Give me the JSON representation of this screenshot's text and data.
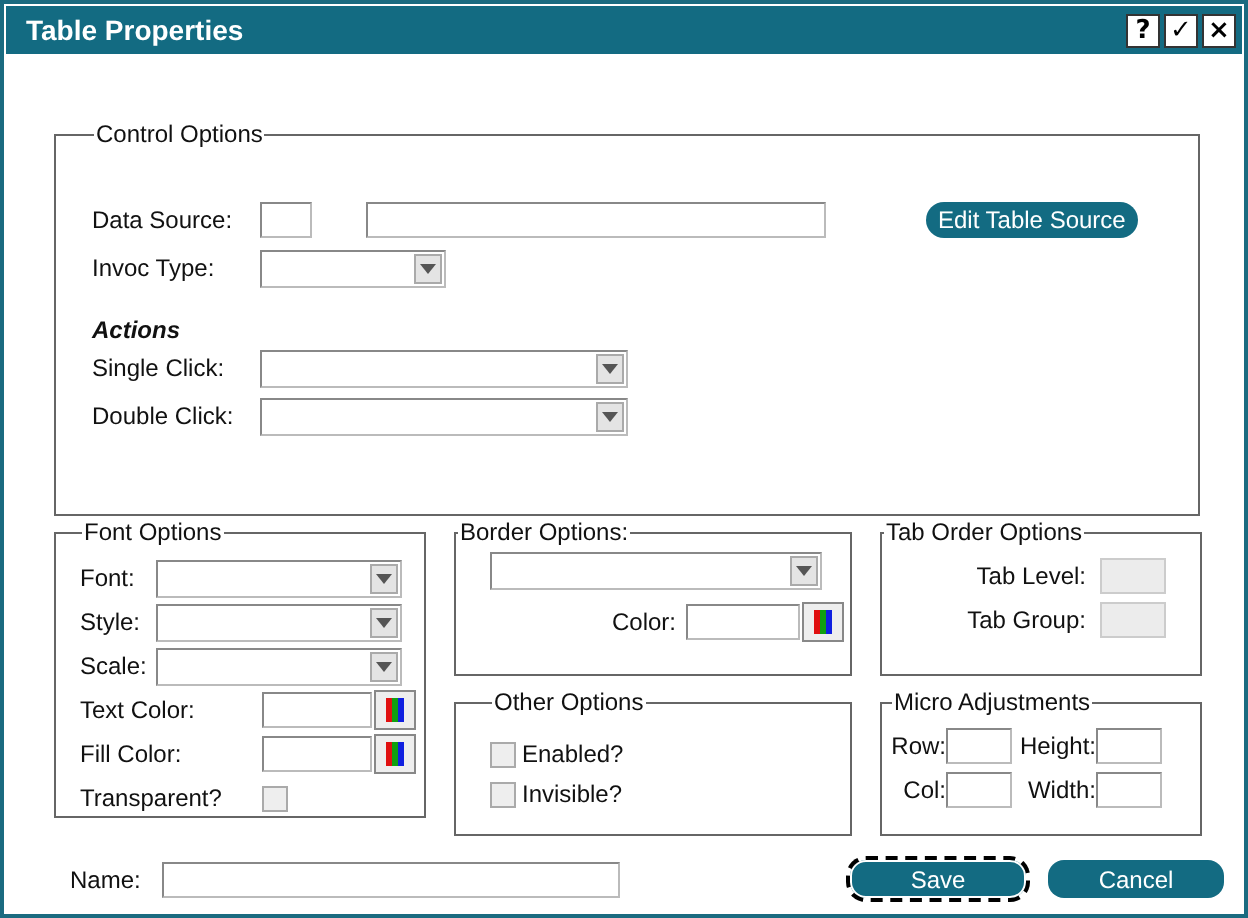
{
  "window": {
    "title": "Table Properties",
    "buttons": [
      "?",
      "✓",
      "×"
    ]
  },
  "control_options": {
    "legend": "Control Options",
    "data_source": {
      "label": "Data Source:"
    },
    "invoc_type": {
      "label": "Invoc Type:"
    },
    "edit_button": "Edit Table Source",
    "actions_heading": "Actions",
    "single_click": {
      "label": "Single Click:"
    },
    "double_click": {
      "label": "Double Click:"
    }
  },
  "font_options": {
    "legend": "Font Options",
    "rows": [
      {
        "kind": "select",
        "label": "Font:"
      },
      {
        "kind": "select",
        "label": "Style:"
      },
      {
        "kind": "select",
        "label": "Scale:"
      },
      {
        "kind": "color",
        "label": "Text Color:"
      },
      {
        "kind": "color",
        "label": "Fill Color:"
      },
      {
        "kind": "checkbox",
        "label": "Transparent?",
        "checked": false
      }
    ]
  },
  "border_options": {
    "legend": "Border Options:",
    "color_label": "Color:"
  },
  "other_options": {
    "legend": "Other Options",
    "checkboxes": [
      {
        "label": "Enabled?",
        "checked": false
      },
      {
        "label": "Invisible?",
        "checked": false
      }
    ]
  },
  "tab_order_options": {
    "legend": "Tab Order Options",
    "fields": [
      {
        "label": "Tab Level:",
        "disabled": true
      },
      {
        "label": "Tab Group:",
        "disabled": true
      }
    ]
  },
  "micro_adjustments": {
    "legend": "Micro Adjustments",
    "fields": [
      {
        "label": "Row:"
      },
      {
        "label": "Height:"
      },
      {
        "label": "Col:"
      },
      {
        "label": "Width:"
      }
    ]
  },
  "name": {
    "label": "Name:"
  },
  "buttons": [
    {
      "label": "Save",
      "focused": true
    },
    {
      "label": "Cancel",
      "focused": false
    }
  ]
}
